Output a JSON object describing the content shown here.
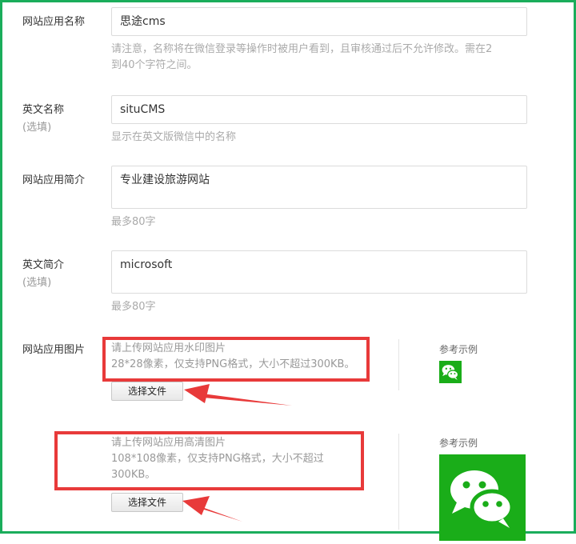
{
  "fields": {
    "app_name": {
      "label": "网站应用名称",
      "value": "思途cms",
      "hint_line1": "请注意，名称将在微信登录等操作时被用户看到，且审核通过后不允许修改。需在2",
      "hint_line2": "到40个字符之间。"
    },
    "en_name": {
      "label": "英文名称",
      "optional": "(选填)",
      "value": "situCMS",
      "hint": "显示在英文版微信中的名称"
    },
    "intro": {
      "label": "网站应用简介",
      "value": "专业建设旅游网站",
      "hint": "最多80字"
    },
    "en_intro": {
      "label": "英文简介",
      "optional": "(选填)",
      "value": "microsoft",
      "hint": "最多80字"
    }
  },
  "images": {
    "label": "网站应用图片",
    "watermark": {
      "hint_line1": "请上传网站应用水印图片",
      "hint_line2": "28*28像素，仅支持PNG格式，大小不超过300KB。",
      "button": "选择文件",
      "ref_label": "参考示例",
      "icon": "wechat-logo-icon"
    },
    "hd": {
      "hint_line1": "请上传网站应用高清图片",
      "hint_line2": "108*108像素，仅支持PNG格式，大小不超过",
      "hint_line3": "300KB。",
      "button": "选择文件",
      "ref_label": "参考示例",
      "icon": "wechat-logo-icon"
    }
  },
  "colors": {
    "frame_green": "#1aad5b",
    "highlight_red": "#e83a3a",
    "wechat_green": "#1aad19"
  }
}
